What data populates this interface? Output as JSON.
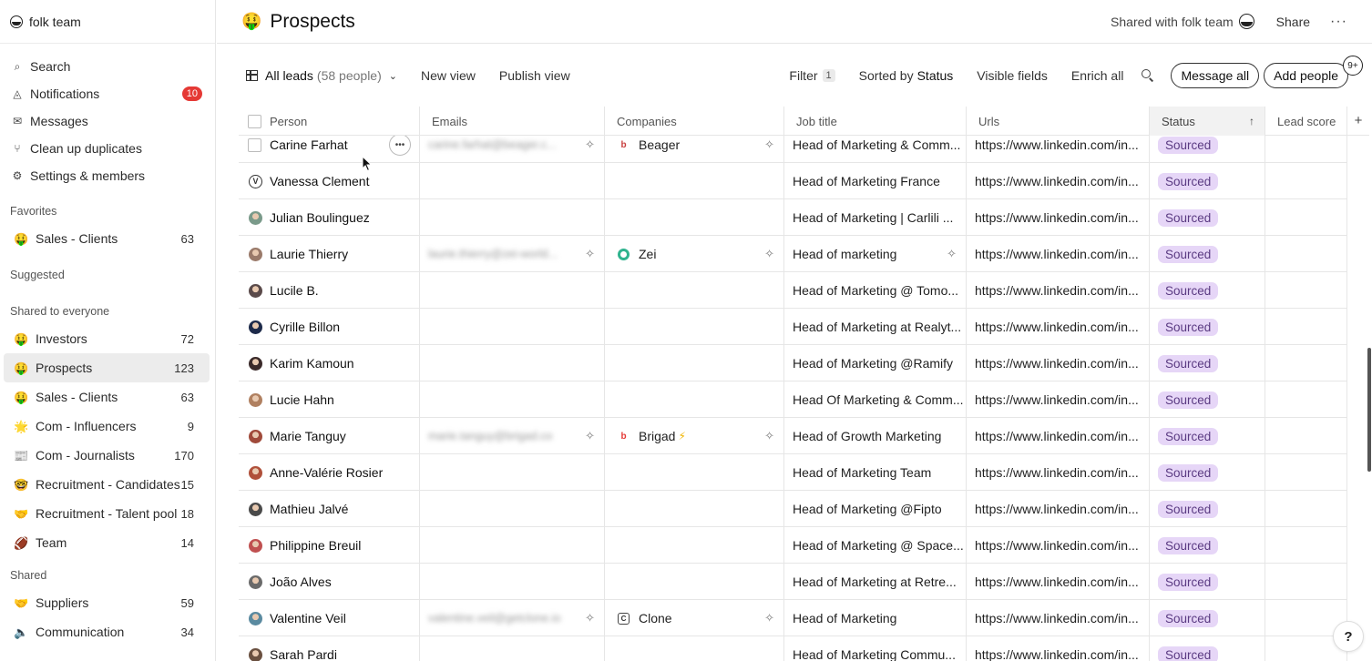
{
  "workspace": {
    "name": "folk team"
  },
  "nav": [
    {
      "label": "Search",
      "icon": "search-icon",
      "glyph": "⌕"
    },
    {
      "label": "Notifications",
      "icon": "bell-icon",
      "glyph": "◬",
      "badge": "10"
    },
    {
      "label": "Messages",
      "icon": "mail-icon",
      "glyph": "✉"
    },
    {
      "label": "Clean up duplicates",
      "icon": "merge-icon",
      "glyph": "⑂"
    },
    {
      "label": "Settings & members",
      "icon": "gear-icon",
      "glyph": "⚙"
    }
  ],
  "favorites": {
    "title": "Favorites",
    "items": [
      {
        "emoji": "🤑",
        "label": "Sales - Clients",
        "count": "63"
      }
    ]
  },
  "suggested": {
    "title": "Suggested"
  },
  "shared_everyone": {
    "title": "Shared to everyone",
    "items": [
      {
        "emoji": "🤑",
        "label": "Investors",
        "count": "72"
      },
      {
        "emoji": "🤑",
        "label": "Prospects",
        "count": "123",
        "active": true
      },
      {
        "emoji": "🤑",
        "label": "Sales - Clients",
        "count": "63"
      },
      {
        "emoji": "🌟",
        "label": "Com - Influencers",
        "count": "9"
      },
      {
        "emoji": "📰",
        "label": "Com - Journalists",
        "count": "170"
      },
      {
        "emoji": "🤓",
        "label": "Recruitment - Candidates",
        "count": "15"
      },
      {
        "emoji": "🤝",
        "label": "Recruitment - Talent pool",
        "count": "18"
      },
      {
        "emoji": "🏈",
        "label": "Team",
        "count": "14"
      }
    ]
  },
  "shared": {
    "title": "Shared",
    "items": [
      {
        "emoji": "🤝",
        "label": "Suppliers",
        "count": "59"
      },
      {
        "emoji": "🔈",
        "label": "Communication",
        "count": "34"
      }
    ]
  },
  "header": {
    "emoji": "🤑",
    "title": "Prospects",
    "shared_with": "Shared with folk team",
    "share": "Share",
    "more": "···"
  },
  "toolbar": {
    "view": "All leads",
    "view_count": "(58 people)",
    "new_view": "New view",
    "publish_view": "Publish view",
    "filter": "Filter",
    "filter_count": "1",
    "sorted_by": "Sorted by",
    "sort_key": "Status",
    "visible_fields": "Visible fields",
    "enrich_all": "Enrich all",
    "message_all": "Message all",
    "add_people": "Add people",
    "badge": "9+"
  },
  "columns": [
    "Person",
    "Emails",
    "Companies",
    "Job title",
    "Urls",
    "Status",
    "Lead score"
  ],
  "rows": [
    {
      "name": "Carine Farhat",
      "avatar": "none",
      "email": "carine.farhat@beager.c...",
      "company": "Beager",
      "company_logo": "b",
      "job": "Head of Marketing & Comm...",
      "url": "https://www.linkedin.com/in...",
      "status": "Sourced",
      "hover": true
    },
    {
      "name": "Vanessa Clement",
      "avatar": "letter",
      "avatar_letter": "V",
      "email": "",
      "company": "",
      "job": "Head of Marketing France",
      "url": "https://www.linkedin.com/in...",
      "status": "Sourced"
    },
    {
      "name": "Julian Boulinguez",
      "avatar": "#7a9a8a",
      "email": "",
      "company": "",
      "job": "Head of Marketing | Carlili ...",
      "url": "https://www.linkedin.com/in...",
      "status": "Sourced"
    },
    {
      "name": "Laurie Thierry",
      "avatar": "#9a7a6a",
      "email": "laurie.thierry@zei-world...",
      "company": "Zei",
      "company_logo": "ring",
      "job": "Head of marketing",
      "url": "https://www.linkedin.com/in...",
      "status": "Sourced",
      "job_sparkle": true
    },
    {
      "name": "Lucile B.",
      "avatar": "#5a4a4a",
      "email": "",
      "company": "",
      "job": "Head of Marketing @ Tomo...",
      "url": "https://www.linkedin.com/in...",
      "status": "Sourced"
    },
    {
      "name": "Cyrille Billon",
      "avatar": "#1d2a4a",
      "email": "",
      "company": "",
      "job": "Head of Marketing at Realyt...",
      "url": "https://www.linkedin.com/in...",
      "status": "Sourced"
    },
    {
      "name": "Karim Kamoun",
      "avatar": "#3a2a2a",
      "email": "",
      "company": "",
      "job": "Head of Marketing @Ramify",
      "url": "https://www.linkedin.com/in...",
      "status": "Sourced"
    },
    {
      "name": "Lucie Hahn",
      "avatar": "#b08060",
      "email": "",
      "company": "",
      "job": "Head Of Marketing & Comm...",
      "url": "https://www.linkedin.com/in...",
      "status": "Sourced"
    },
    {
      "name": "Marie Tanguy",
      "avatar": "#a04a3a",
      "email": "marie.tanguy@brigad.co",
      "company": "Brigad",
      "company_logo": "brigad",
      "company_bolt": true,
      "job": "Head of Growth Marketing",
      "url": "https://www.linkedin.com/in...",
      "status": "Sourced"
    },
    {
      "name": "Anne-Valérie Rosier",
      "avatar": "#b0503a",
      "email": "",
      "company": "",
      "job": "Head of Marketing Team",
      "url": "https://www.linkedin.com/in...",
      "status": "Sourced"
    },
    {
      "name": "Mathieu Jalvé",
      "avatar": "#4a4a4a",
      "email": "",
      "company": "",
      "job": "Head of Marketing @Fipto",
      "url": "https://www.linkedin.com/in...",
      "status": "Sourced"
    },
    {
      "name": "Philippine Breuil",
      "avatar": "#c05050",
      "email": "",
      "company": "",
      "job": "Head of Marketing @ Space...",
      "url": "https://www.linkedin.com/in...",
      "status": "Sourced"
    },
    {
      "name": "João Alves",
      "avatar": "#6a6a6a",
      "email": "",
      "company": "",
      "job": "Head of Marketing at Retre...",
      "url": "https://www.linkedin.com/in...",
      "status": "Sourced"
    },
    {
      "name": "Valentine Veil",
      "avatar": "#5a8aa0",
      "email": "valentine.veil@getclone.io",
      "company": "Clone",
      "company_logo": "box",
      "company_letter": "C",
      "job": "Head of Marketing",
      "url": "https://www.linkedin.com/in...",
      "status": "Sourced"
    },
    {
      "name": "Sarah Pardi",
      "avatar": "#6a5040",
      "email": "",
      "company": "",
      "job": "Head of Marketing Commu...",
      "url": "https://www.linkedin.com/in...",
      "status": "Sourced"
    }
  ],
  "help": "?"
}
